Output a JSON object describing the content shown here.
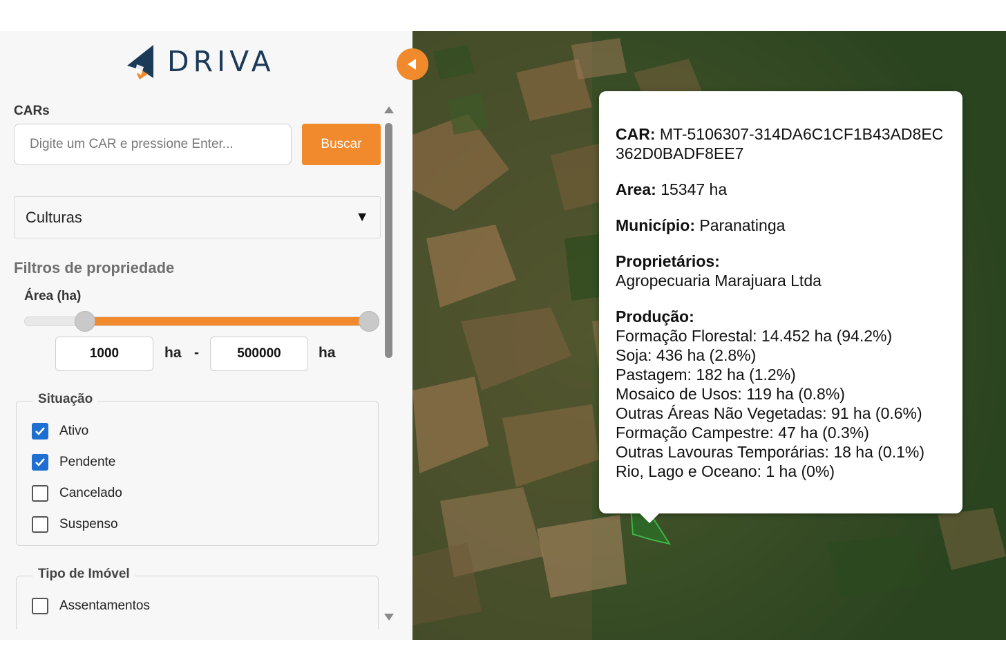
{
  "brand": {
    "name": "DRIVA",
    "primary_color": "#1a3a58",
    "accent_color": "#f08a2c"
  },
  "sidebar": {
    "collapse_icon": "chevron-left-icon",
    "cars_label": "CARs",
    "car_search": {
      "placeholder": "Digite um CAR e pressione Enter...",
      "value": ""
    },
    "search_button": "Buscar",
    "crop_select": {
      "selected": "Culturas",
      "caret": "▼"
    },
    "filters_title": "Filtros de propriedade",
    "area": {
      "label": "Área (ha)",
      "min": "1000",
      "max": "500000",
      "unit": "ha",
      "separator": "-",
      "slider_min_fraction": 0.15,
      "slider_max_fraction": 1.0
    },
    "situacao": {
      "legend": "Situação",
      "options": [
        {
          "label": "Ativo",
          "checked": true
        },
        {
          "label": "Pendente",
          "checked": true
        },
        {
          "label": "Cancelado",
          "checked": false
        },
        {
          "label": "Suspenso",
          "checked": false
        }
      ]
    },
    "tipo_imovel": {
      "legend": "Tipo de Imóvel",
      "options": [
        {
          "label": "Assentamentos",
          "checked": false
        }
      ]
    }
  },
  "popup": {
    "car_label": "CAR:",
    "car_value": "MT-5106307-314DA6C1CF1B43AD8EC362D0BADF8EE7",
    "area_label": "Area:",
    "area_value": "15347 ha",
    "municipio_label": "Município:",
    "municipio_value": "Paranatinga",
    "proprietarios_label": "Proprietários:",
    "proprietarios_value": "Agropecuaria Marajuara Ltda",
    "producao_label": "Produção:",
    "producao": [
      "Formação Florestal: 14.452 ha (94.2%)",
      "Soja: 436 ha (2.8%)",
      "Pastagem: 182 ha (1.2%)",
      "Mosaico de Usos: 119 ha (0.8%)",
      "Outras Áreas Não Vegetadas: 91 ha (0.6%)",
      "Formação Campestre: 47 ha (0.3%)",
      "Outras Lavouras Temporárias: 18 ha (0.1%)",
      "Rio, Lago e Oceano: 1 ha (0%)"
    ]
  }
}
